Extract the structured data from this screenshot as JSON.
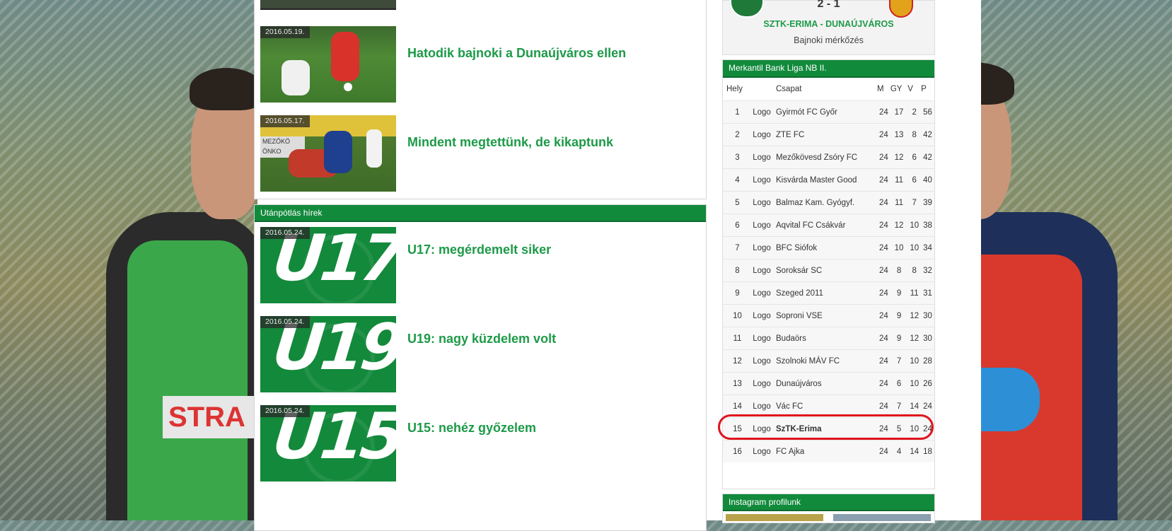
{
  "main": {
    "news": [
      {
        "date": "2016.05.19.",
        "title": "Hatodik bajnoki a Dunaújváros ellen"
      },
      {
        "date": "2016.05.17.",
        "title": "Mindent megtettünk, de kikaptunk"
      }
    ],
    "youth": {
      "heading": "Utánpótlás hírek",
      "items": [
        {
          "date": "2016.05.24.",
          "badge": "U17",
          "title": "U17: megérdemelt siker"
        },
        {
          "date": "2016.05.24.",
          "badge": "U19",
          "title": "U19: nagy küzdelem volt"
        },
        {
          "date": "2016.05.24.",
          "badge": "U15",
          "title": "U15: nehéz győzelem"
        }
      ]
    }
  },
  "sidebar": {
    "match": {
      "score": "2 - 1",
      "teams": "SZTK-ERIMA - DUNAÚJVÁROS",
      "type": "Bajnoki mérkőzés"
    },
    "league": {
      "heading": "Merkantil Bank Liga NB II.",
      "columns": {
        "pos": "Hely",
        "team": "Csapat",
        "m": "M",
        "gy": "GY",
        "v": "V",
        "p": "P"
      },
      "rows": [
        {
          "pos": "1",
          "logo": "Logo",
          "team": "Gyirmót FC Győr",
          "m": "24",
          "gy": "17",
          "v": "2",
          "p": "56"
        },
        {
          "pos": "2",
          "logo": "Logo",
          "team": "ZTE FC",
          "m": "24",
          "gy": "13",
          "v": "8",
          "p": "42"
        },
        {
          "pos": "3",
          "logo": "Logo",
          "team": "Mezőkövesd Zsóry FC",
          "m": "24",
          "gy": "12",
          "v": "6",
          "p": "42"
        },
        {
          "pos": "4",
          "logo": "Logo",
          "team": "Kisvárda Master Good",
          "m": "24",
          "gy": "11",
          "v": "6",
          "p": "40"
        },
        {
          "pos": "5",
          "logo": "Logo",
          "team": "Balmaz Kam. Gyógyf.",
          "m": "24",
          "gy": "11",
          "v": "7",
          "p": "39"
        },
        {
          "pos": "6",
          "logo": "Logo",
          "team": "Aqvital FC Csákvár",
          "m": "24",
          "gy": "12",
          "v": "10",
          "p": "38"
        },
        {
          "pos": "7",
          "logo": "Logo",
          "team": "BFC Siófok",
          "m": "24",
          "gy": "10",
          "v": "10",
          "p": "34"
        },
        {
          "pos": "8",
          "logo": "Logo",
          "team": "Soroksár SC",
          "m": "24",
          "gy": "8",
          "v": "8",
          "p": "32"
        },
        {
          "pos": "9",
          "logo": "Logo",
          "team": "Szeged 2011",
          "m": "24",
          "gy": "9",
          "v": "11",
          "p": "31"
        },
        {
          "pos": "10",
          "logo": "Logo",
          "team": "Soproni VSE",
          "m": "24",
          "gy": "9",
          "v": "12",
          "p": "30"
        },
        {
          "pos": "11",
          "logo": "Logo",
          "team": "Budaörs",
          "m": "24",
          "gy": "9",
          "v": "12",
          "p": "30"
        },
        {
          "pos": "12",
          "logo": "Logo",
          "team": "Szolnoki MÁV FC",
          "m": "24",
          "gy": "7",
          "v": "10",
          "p": "28"
        },
        {
          "pos": "13",
          "logo": "Logo",
          "team": "Dunaújváros",
          "m": "24",
          "gy": "6",
          "v": "10",
          "p": "26"
        },
        {
          "pos": "14",
          "logo": "Logo",
          "team": "Vác FC",
          "m": "24",
          "gy": "7",
          "v": "14",
          "p": "24"
        },
        {
          "pos": "15",
          "logo": "Logo",
          "team": "SzTK-Erima",
          "m": "24",
          "gy": "5",
          "v": "10",
          "p": "24"
        },
        {
          "pos": "16",
          "logo": "Logo",
          "team": "FC Ajka",
          "m": "24",
          "gy": "4",
          "v": "14",
          "p": "18"
        }
      ],
      "highlight_pos": "15"
    },
    "instagram": {
      "heading": "Instagram profilunk"
    }
  },
  "colors": {
    "brand_green": "#128a3c",
    "title_green": "#1d9a48",
    "highlight_red": "#e0141e"
  }
}
